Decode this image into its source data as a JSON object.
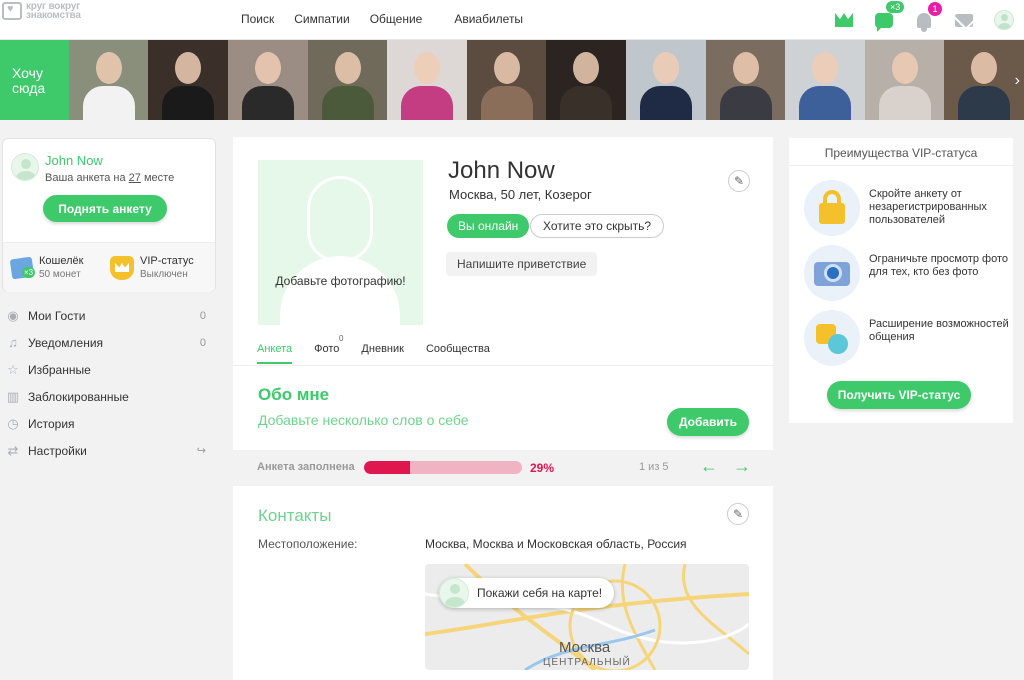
{
  "header": {
    "logo_line1": "круг вокруг",
    "logo_line2": "знакомства",
    "nav": [
      "Поиск",
      "Симпатии",
      "Общение",
      "Авиабилеты"
    ],
    "chat_badge": "×3",
    "notify_badge": "1"
  },
  "strip": {
    "want_here": "Хочу сюда",
    "thumbs": [
      {
        "bg": "#8a8f7c",
        "shirt": "#f2f2f2"
      },
      {
        "bg": "#3b2f2a",
        "shirt": "#1a1a1a"
      },
      {
        "bg": "#9b8c84",
        "shirt": "#2a2a2a"
      },
      {
        "bg": "#6f6a5a",
        "shirt": "#4b5a3a"
      },
      {
        "bg": "#ddd7d6",
        "shirt": "#c43c82"
      },
      {
        "bg": "#5c4c40",
        "shirt": "#8a6e5a"
      },
      {
        "bg": "#2b2420",
        "shirt": "#3a302a"
      },
      {
        "bg": "#bfc6cc",
        "shirt": "#1f2a44"
      },
      {
        "bg": "#7a6c5e",
        "shirt": "#3b3b44"
      },
      {
        "bg": "#cfd2d4",
        "shirt": "#3d5f9a"
      },
      {
        "bg": "#b6b0a8",
        "shirt": "#d9d2cc"
      },
      {
        "bg": "#6b5a4a",
        "shirt": "#2d3a4a"
      }
    ]
  },
  "profile_card": {
    "name": "John Now",
    "rank_prefix": "Ваша анкета на ",
    "rank_num": "27",
    "rank_suffix": " месте",
    "raise_button": "Поднять анкету",
    "wallet_title": "Кошелёк",
    "wallet_sub": "50 монет",
    "wallet_badge": "×3",
    "vip_title": "VIP-статус",
    "vip_sub": "Выключен"
  },
  "side_menu": [
    {
      "label": "Мои Гости",
      "count": "0",
      "icon": "◉"
    },
    {
      "label": "Уведомления",
      "count": "0",
      "icon": "♫"
    },
    {
      "label": "Избранные",
      "count": "",
      "icon": "☆"
    },
    {
      "label": "Заблокированные",
      "count": "",
      "icon": "▥"
    },
    {
      "label": "История",
      "count": "",
      "icon": "◷"
    },
    {
      "label": "Настройки",
      "count": "↪",
      "icon": "⇄"
    }
  ],
  "main": {
    "photo_text": "Добавьте фотографию!",
    "name": "John Now",
    "sub": "Москва, 50 лет, Козерог",
    "online": "Вы онлайн",
    "hide": "Хотите это скрыть?",
    "greeting": "Напишите приветствие",
    "tabs": [
      {
        "label": "Анкета",
        "count": ""
      },
      {
        "label": "Фото",
        "count": "0"
      },
      {
        "label": "Дневник",
        "count": ""
      },
      {
        "label": "Сообщества",
        "count": ""
      }
    ],
    "about_title": "Обо мне",
    "about_placeholder": "Добавьте несколько слов о себе",
    "about_add": "Добавить",
    "progress_label": "Анкета заполнена",
    "progress_percent": 29,
    "progress_text": "29%",
    "page_text": "1 из 5",
    "contacts_title": "Контакты",
    "location_label": "Местоположение:",
    "location_value": "Москва, Москва и Московская область, Россия",
    "map_bubble": "Покажи себя на карте!",
    "map_city": "Москва",
    "map_district": "ЦЕНТРАЛЬНЫЙ"
  },
  "vip": {
    "title": "Преимущества VIP-статуса",
    "items": [
      "Скройте анкету от незарегистрированных пользователей",
      "Ограничьте просмотр фото для тех, кто без фото",
      "Расширение возможностей общения"
    ],
    "button": "Получить VIP-статус"
  },
  "colors": {
    "accent": "#3ec96a",
    "danger": "#e0174e"
  }
}
